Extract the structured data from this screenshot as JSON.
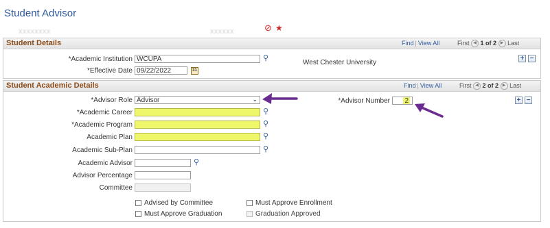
{
  "page": {
    "title": "Student Advisor",
    "blurred_id": "XXXXXXXX",
    "blurred_name": "XXXXXX",
    "prohibited_icon": "prohibited-icon",
    "star_icon": "star-icon"
  },
  "student_details": {
    "title": "Student Details",
    "nav": {
      "find": "Find",
      "sep": "|",
      "view_all": "View All",
      "first": "First",
      "range": "1 of 2",
      "last": "Last"
    },
    "fields": {
      "academic_institution": {
        "label": "*Academic Institution",
        "value": "WCUPA",
        "description": "West Chester University"
      },
      "effective_date": {
        "label": "*Effective Date",
        "value": "09/22/2022"
      }
    },
    "calendar_icon_text": "31"
  },
  "student_academic_details": {
    "title": "Student Academic Details",
    "nav": {
      "find": "Find",
      "sep": "|",
      "view_all": "View All",
      "first": "First",
      "range": "2 of 2",
      "last": "Last"
    },
    "fields": {
      "advisor_role": {
        "label": "*Advisor Role",
        "value": "Advisor"
      },
      "advisor_number": {
        "label": "*Advisor Number",
        "value": "2"
      },
      "academic_career": {
        "label": "*Academic Career",
        "value": ""
      },
      "academic_program": {
        "label": "*Academic Program",
        "value": ""
      },
      "academic_plan": {
        "label": "Academic Plan",
        "value": ""
      },
      "academic_sub_plan": {
        "label": "Academic Sub-Plan",
        "value": ""
      },
      "academic_advisor": {
        "label": "Academic Advisor",
        "value": ""
      },
      "advisor_percentage": {
        "label": "Advisor Percentage",
        "value": ""
      },
      "committee": {
        "label": "Committee",
        "value": ""
      }
    },
    "checkboxes": {
      "advised_by_committee": "Advised by Committee",
      "must_approve_enrollment": "Must Approve Enrollment",
      "must_approve_graduation": "Must Approve Graduation",
      "graduation_approved": "Graduation Approved"
    }
  },
  "colors": {
    "highlight": "#eef76a",
    "annotation_arrow": "#6a2c91",
    "section_title": "#8a4b18",
    "link": "#2f5b9c"
  }
}
